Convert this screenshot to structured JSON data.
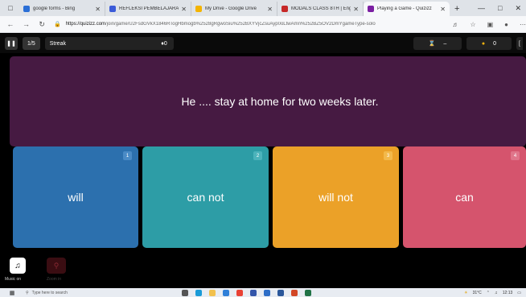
{
  "browser": {
    "tabs": [
      {
        "label": "google forms - Bing",
        "color": "#2b6fd6",
        "active": false
      },
      {
        "label": "REFLEKSI PEMBELAJARAN M",
        "color": "#3b5bd8",
        "active": false
      },
      {
        "label": "My Drive - Google Drive",
        "color": "#f4b400",
        "active": false
      },
      {
        "label": "MODALS CLASS 8TH | English",
        "color": "#c62828",
        "active": false
      },
      {
        "label": "Playing a Game - Quizizz",
        "color": "#7b1fa2",
        "active": true
      }
    ],
    "url_host": "https://quizizz.com",
    "url_path": "/join/game/U2FsdGVkX1846RTogHbmogb%2528gRgwoSiu%252BXYVjcZsuAyp0oLtwAmn%252BZ5OV2DmYgameType-solo"
  },
  "header": {
    "question_counter": "1/5",
    "streak_label": "Streak",
    "streak_value": "0",
    "powerups_value": "–",
    "score_value": "0"
  },
  "question": {
    "text": "He .... stay at home for two weeks later."
  },
  "options": [
    {
      "number": "1",
      "label": "will",
      "color": "#2c70ae"
    },
    {
      "number": "2",
      "label": "can not",
      "color": "#2d9da6"
    },
    {
      "number": "3",
      "label": "will not",
      "color": "#eba128"
    },
    {
      "number": "4",
      "label": "can",
      "color": "#d5546d"
    }
  ],
  "toolbar": {
    "music_label": "Music on",
    "zoom_label": "Zoom in"
  },
  "taskbar": {
    "search_placeholder": "Type here to search",
    "weather": "31°C",
    "time": "12:13"
  }
}
